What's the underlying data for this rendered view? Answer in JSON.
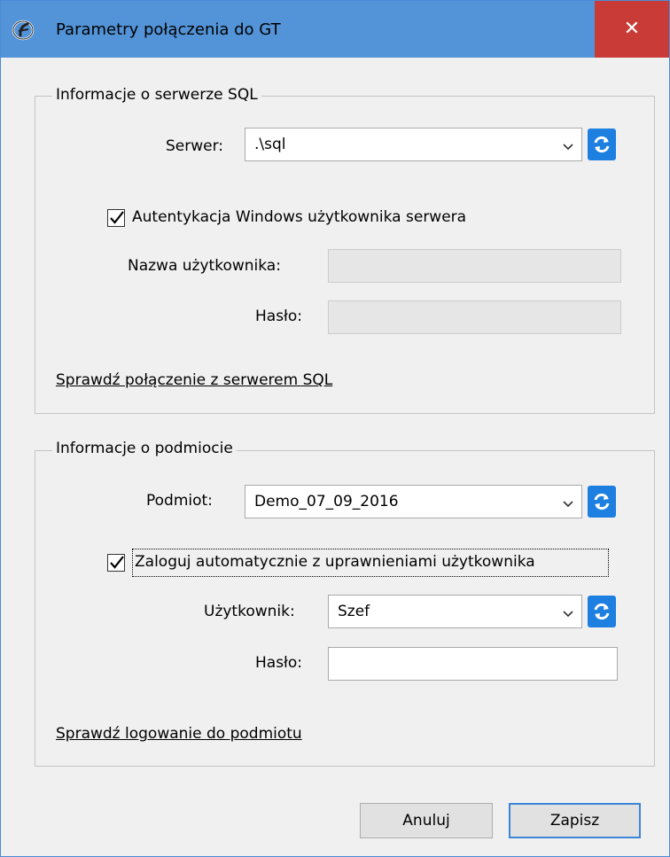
{
  "window": {
    "title": "Parametry połączenia do GT",
    "close_glyph": "✕",
    "app_icon": "app-logo-icon"
  },
  "sql_server": {
    "legend": "Informacje o serwerze SQL",
    "server_label": "Serwer:",
    "server_value": ".\\sql",
    "windows_auth_checked": true,
    "windows_auth_label": "Autentykacja Windows użytkownika serwera",
    "username_label": "Nazwa użytkownika:",
    "username_value": "",
    "password_label": "Hasło:",
    "password_value": "",
    "test_link": "Sprawdź połączenie z serwerem SQL"
  },
  "entity": {
    "legend": "Informacje o podmiocie",
    "entity_label": "Podmiot:",
    "entity_value": "Demo_07_09_2016",
    "auto_login_checked": true,
    "auto_login_label": "Zaloguj automatycznie z uprawnieniami użytkownika",
    "user_label": "Użytkownik:",
    "user_value": "Szef",
    "password_label": "Hasło:",
    "password_value": "",
    "test_link": "Sprawdź logowanie do podmiotu"
  },
  "buttons": {
    "cancel_label": "Anuluj",
    "save_label": "Zapisz"
  },
  "colors": {
    "titlebar": "#5394d8",
    "close": "#c93b36",
    "refresh": "#1d7fe0"
  }
}
